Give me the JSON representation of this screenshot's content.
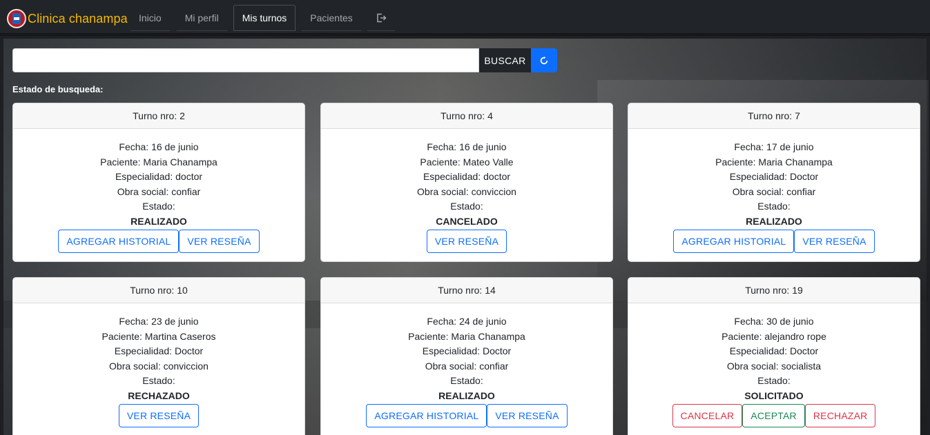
{
  "brand": {
    "name": "Clinica chanampa",
    "logo_icon": "clinic-logo-icon"
  },
  "nav": {
    "items": [
      {
        "label": "Inicio",
        "active": false
      },
      {
        "label": "Mi perfil",
        "active": false
      },
      {
        "label": "Mis turnos",
        "active": true
      },
      {
        "label": "Pacientes",
        "active": false
      }
    ],
    "logout_icon": "logout-icon"
  },
  "search": {
    "value": "",
    "placeholder": "",
    "button_label": "BUSCAR",
    "reset_icon": "refresh-icon",
    "status_label": "Estado de busqueda:"
  },
  "labels": {
    "fecha": "Fecha: ",
    "paciente": "Paciente: ",
    "especialidad": "Especialidad: ",
    "obra_social": "Obra social: ",
    "estado": "Estado:",
    "turno": "Turno nro: "
  },
  "cards": [
    {
      "turno": "Turno nro: 2",
      "fecha": "Fecha: 16 de junio",
      "paciente": "Paciente: Maria Chanampa",
      "especialidad": "Especialidad: doctor",
      "obra_social": "Obra social: confiar",
      "estado_label": "Estado:",
      "estado": "REALIZADO",
      "buttons": [
        {
          "label": "AGREGAR HISTORIAL",
          "kind": "primary"
        },
        {
          "label": "VER RESEÑA",
          "kind": "primary"
        }
      ]
    },
    {
      "turno": "Turno nro: 4",
      "fecha": "Fecha: 16 de junio",
      "paciente": "Paciente: Mateo Valle",
      "especialidad": "Especialidad: doctor",
      "obra_social": "Obra social: conviccion",
      "estado_label": "Estado:",
      "estado": "CANCELADO",
      "buttons": [
        {
          "label": "VER RESEÑA",
          "kind": "primary"
        }
      ]
    },
    {
      "turno": "Turno nro: 7",
      "fecha": "Fecha: 17 de junio",
      "paciente": "Paciente: Maria Chanampa",
      "especialidad": "Especialidad: Doctor",
      "obra_social": "Obra social: confiar",
      "estado_label": "Estado:",
      "estado": "REALIZADO",
      "buttons": [
        {
          "label": "AGREGAR HISTORIAL",
          "kind": "primary"
        },
        {
          "label": "VER RESEÑA",
          "kind": "primary"
        }
      ]
    },
    {
      "turno": "Turno nro: 10",
      "fecha": "Fecha: 23 de junio",
      "paciente": "Paciente: Martina Caseros",
      "especialidad": "Especialidad: Doctor",
      "obra_social": "Obra social: conviccion",
      "estado_label": "Estado:",
      "estado": "RECHAZADO",
      "buttons": [
        {
          "label": "VER RESEÑA",
          "kind": "primary"
        }
      ]
    },
    {
      "turno": "Turno nro: 14",
      "fecha": "Fecha: 24 de junio",
      "paciente": "Paciente: Maria Chanampa",
      "especialidad": "Especialidad: Doctor",
      "obra_social": "Obra social: confiar",
      "estado_label": "Estado:",
      "estado": "REALIZADO",
      "buttons": [
        {
          "label": "AGREGAR HISTORIAL",
          "kind": "primary"
        },
        {
          "label": "VER RESEÑA",
          "kind": "primary"
        }
      ]
    },
    {
      "turno": "Turno nro: 19",
      "fecha": "Fecha: 30 de junio",
      "paciente": "Paciente: alejandro rope",
      "especialidad": "Especialidad: Doctor",
      "obra_social": "Obra social: socialista",
      "estado_label": "Estado:",
      "estado": "SOLICITADO",
      "buttons": [
        {
          "label": "CANCELAR",
          "kind": "danger"
        },
        {
          "label": "ACEPTAR",
          "kind": "success"
        },
        {
          "label": "RECHAZAR",
          "kind": "danger"
        }
      ]
    }
  ],
  "colors": {
    "brand": "#f5b800",
    "navbar": "#212529",
    "primary": "#0d6efd",
    "danger": "#dc3545",
    "success": "#198754"
  }
}
